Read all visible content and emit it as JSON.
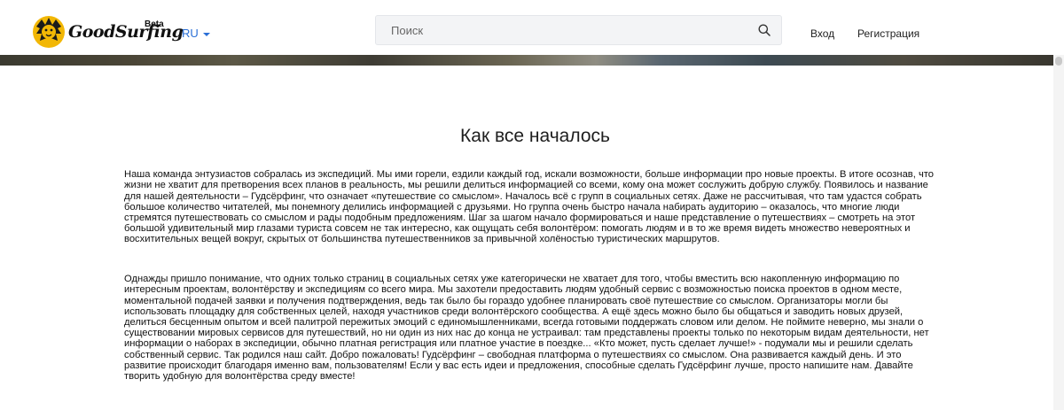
{
  "header": {
    "logo_text": "GoodSurfing",
    "logo_badge": "Beta",
    "language": "RU",
    "search": {
      "placeholder": "Поиск",
      "value": ""
    },
    "nav": {
      "login": "Вход",
      "register": "Регистрация"
    }
  },
  "main": {
    "title": "Как все началось",
    "paragraphs": [
      "Наша команда энтузиастов собралась из экспедиций. Мы ими горели, ездили каждый год, искали возможности, больше информации про новые проекты. В итоге осознав, что жизни не хватит для претворения всех планов в реальность, мы решили делиться информацией со всеми, кому она может сослужить добрую службу. Появилось и название для нашей деятельности – Гудсёрфинг, что означает «путешествие со смыслом». Началось всё с групп в социальных сетях. Даже не рассчитывая, что там удастся собрать большое количество читателей, мы понемногу делились информацией с друзьями. Но группа очень быстро начала набирать аудиторию – оказалось, что многие люди стремятся путешествовать со смыслом и рады подобным предложениям. Шаг за шагом начало формироваться и наше представление о путешествиях – смотреть на этот большой удивительный мир глазами туриста совсем не так интересно, как ощущать себя волонтёром: помогать людям и в то же время видеть множество невероятных и восхитительных вещей вокруг, скрытых от большинства путешественников за привычной холёностью туристических маршрутов.",
      "Однажды пришло понимание, что одних только страниц в социальных сетях уже категорически не хватает для того, чтобы вместить всю накопленную информацию по интересным проектам, волонтёрству и экспедициям со всего мира. Мы захотели предоставить людям удобный сервис с возможностью поиска проектов в одном месте, моментальной подачей заявки и получения подтверждения, ведь так было бы гораздо удобнее планировать своё путешествие со смыслом. Организаторы могли бы использовать площадку для собственных целей, находя участников среди волонтёрского сообщества. А ещё здесь можно было бы общаться и заводить новых друзей, делиться бесценным опытом и всей палитрой пережитых эмоций с единомышленниками, всегда готовыми поддержать словом или делом. Не поймите неверно, мы знали о существовании мировых сервисов для путешествий, но ни один из них нас до конца не устраивал: там представлены проекты только по некоторым видам деятельности, нет информации о наборах в экспедиции, обычно платная регистрация или платное участие в поездке... «Кто может, пусть сделает лучше!» - подумали мы и решили сделать собственный сервис. Так родился наш сайт. Добро пожаловать! Гудсёрфинг – свободная платформа о путешествиях со смыслом. Она развивается каждый день. И это развитие происходит благодаря именно вам, пользователям! Если у вас есть идеи и предложения, способные сделать Гудсёрфинг лучше, просто напишите нам. Давайте творить удобную для волонтёрства среду вместе!"
    ]
  },
  "icons": {
    "logo": "lion-logo-icon",
    "search": "search-icon",
    "language_caret": "chevron-down-icon"
  },
  "colors": {
    "accent": "#2a6fd6",
    "logo_yellow": "#f2b705"
  }
}
